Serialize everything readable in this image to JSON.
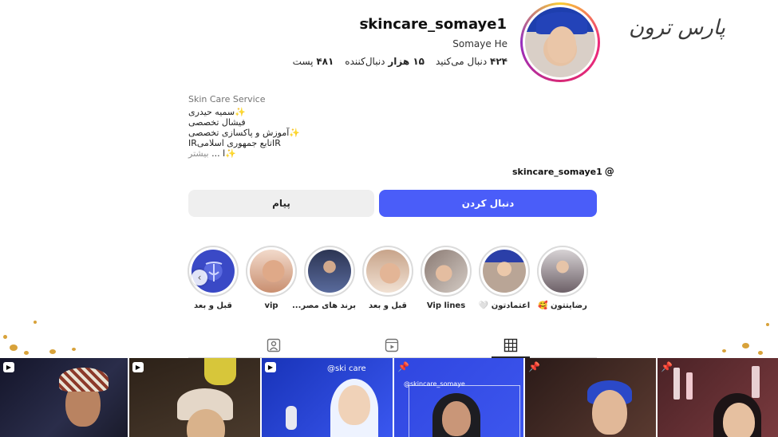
{
  "brand": {
    "logo_text": "پارس ترون"
  },
  "profile": {
    "username": "skincare_somaye1",
    "more_label": "···",
    "full_name": "Somaye He",
    "stats": {
      "posts": {
        "value": "۴۸۱",
        "label": "پست"
      },
      "followers": {
        "value": "۱۵ هزار",
        "label": "دنبال‌کننده"
      },
      "following": {
        "value": "۴۲۴",
        "label": "دنبال می‌کنید"
      }
    }
  },
  "bio": {
    "category": "Skin Care Service",
    "lines": [
      "✨سمیه حیدری",
      "فیشال تخصصی",
      "✨آموزش و پاکسازی تخصصی",
      "IRتابع جمهوری اسلامیIR",
      "✨ا ..."
    ],
    "more": "بیشتر",
    "threads_handle": "skincare_somaye1",
    "threads_icon": "@"
  },
  "actions": {
    "follow_label": "دنبال کردن",
    "message_label": "پیام"
  },
  "highlights": [
    {
      "label": "رضایتتون 🥰",
      "tone": "#c9c2c4"
    },
    {
      "label": "اعتمادتون 🤍",
      "tone": "#b9a596"
    },
    {
      "label": "Vip lines",
      "tone": "#8a7a73"
    },
    {
      "label": "قبل و بعد",
      "tone": "#c8a48a"
    },
    {
      "label": "برند های مصر...",
      "tone": "#2c3553"
    },
    {
      "label": "vip",
      "tone": "#d9a98a"
    },
    {
      "label": "قبل و بعد",
      "tone": "#3a49c6"
    }
  ],
  "tabs": {
    "tagged_icon": "tagged-icon",
    "reels_icon": "reels-icon",
    "grid_icon": "grid-icon",
    "active": "grid"
  },
  "colors": {
    "follow_button": "#4a5df9",
    "message_button": "#efefef",
    "gold_splash": "#d8a23a"
  },
  "posts": [
    {
      "type": "reel",
      "bg": "#1a1b2b",
      "face": "#b98361"
    },
    {
      "type": "reel",
      "bg": "#3a2c22",
      "face": "#d9b28b"
    },
    {
      "type": "reel",
      "bg": "#2a3fd8",
      "face": "#f0d2b8",
      "caption": "@ski care"
    },
    {
      "type": "pinned",
      "bg": "#2f46e0",
      "face": "#c99678",
      "caption": "@skincare_somaye"
    },
    {
      "type": "pinned",
      "bg": "#3a2420",
      "face": "#e1b898"
    },
    {
      "type": "pinned",
      "bg": "#3b1f22",
      "face": "#e6c0a0"
    }
  ]
}
